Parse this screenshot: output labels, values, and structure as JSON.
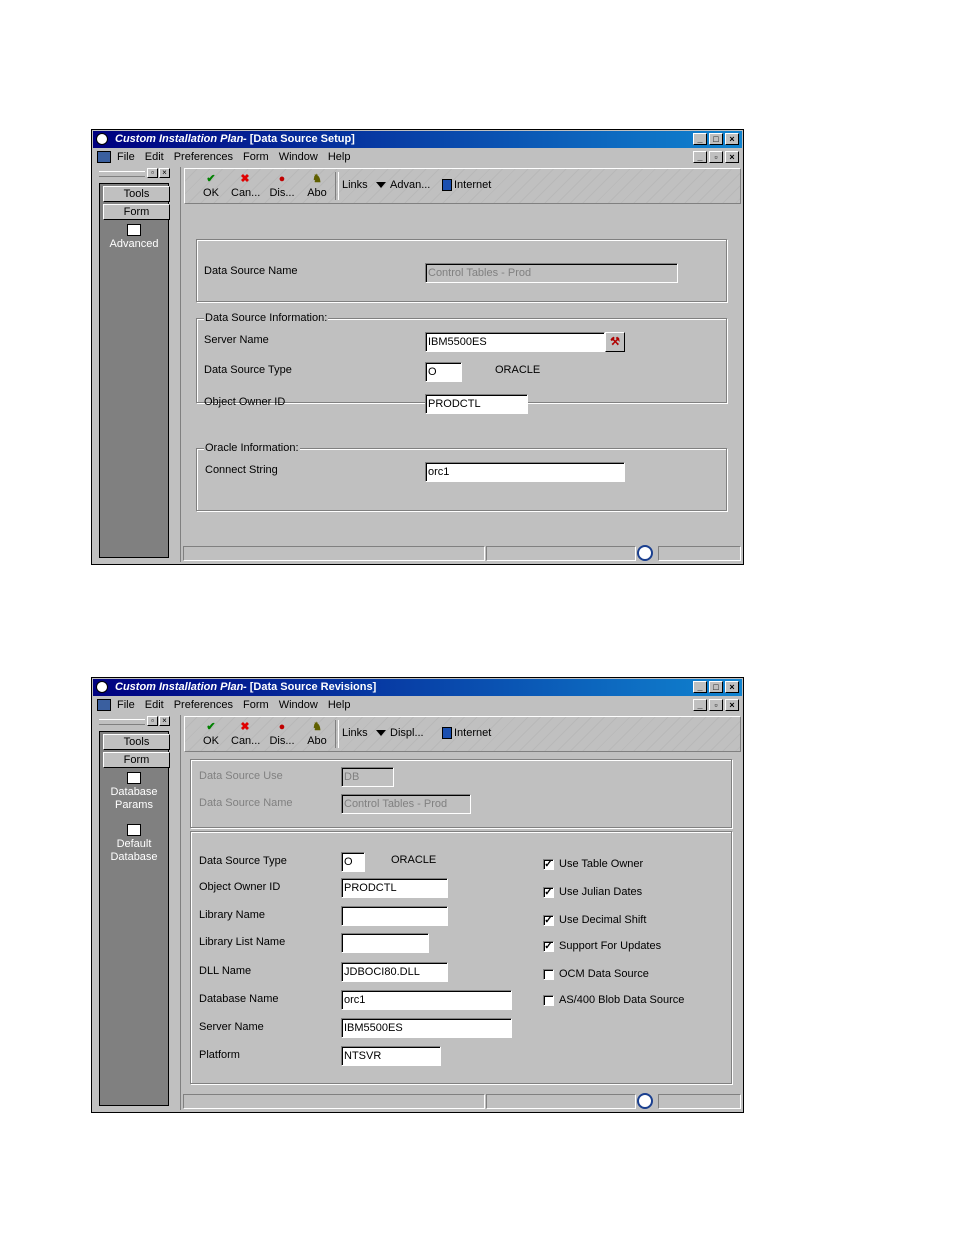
{
  "windows": [
    {
      "title": {
        "app": "Custom Installation Plan",
        "form": " - [Data Source Setup]"
      },
      "menu": [
        "File",
        "Edit",
        "Preferences",
        "Form",
        "Window",
        "Help"
      ],
      "left_panel": {
        "tabs": [
          "Tools",
          "Form"
        ],
        "items": [
          "Advanced"
        ]
      },
      "toolbar": {
        "buttons": [
          "OK",
          "Can...",
          "Dis...",
          "Abo"
        ],
        "links": "Links",
        "dropdown": "Advan...",
        "internet": "Internet"
      }
    },
    {
      "title": {
        "app": "Custom Installation Plan",
        "form": " - [Data Source Revisions]"
      },
      "menu": [
        "File",
        "Edit",
        "Preferences",
        "Form",
        "Window",
        "Help"
      ],
      "left_panel": {
        "tabs": [
          "Tools",
          "Form"
        ],
        "items": [
          "Database Params",
          "Default Database"
        ]
      },
      "toolbar": {
        "buttons": [
          "OK",
          "Can...",
          "Dis...",
          "Abo"
        ],
        "links": "Links",
        "dropdown": "Displ...",
        "internet": "Internet"
      }
    }
  ],
  "setup_form": {
    "data_source_name_label": "Data Source Name",
    "data_source_name_value": "Control Tables - Prod",
    "group_ds_info": "Data Source Information:",
    "server_name_label": "Server Name",
    "server_name_value": "IBM5500ES",
    "data_source_type_label": "Data Source Type",
    "data_source_type_value": "O",
    "data_source_type_desc": "ORACLE",
    "object_owner_label": "Object Owner ID",
    "object_owner_value": "PRODCTL",
    "group_oracle": "Oracle Information:",
    "connect_string_label": "Connect String",
    "connect_string_value": "orc1"
  },
  "revisions_form": {
    "data_source_use_label": "Data Source Use",
    "data_source_use_value": "DB",
    "data_source_name_label": "Data Source Name",
    "data_source_name_value": "Control Tables - Prod",
    "data_source_type_label": "Data Source Type",
    "data_source_type_value": "O",
    "data_source_type_desc": "ORACLE",
    "object_owner_label": "Object Owner ID",
    "object_owner_value": "PRODCTL",
    "library_name_label": "Library Name",
    "library_name_value": "",
    "library_list_label": "Library List Name",
    "library_list_value": "",
    "dll_name_label": "DLL Name",
    "dll_name_value": "JDBOCI80.DLL",
    "database_name_label": "Database Name",
    "database_name_value": "orc1",
    "server_name_label": "Server Name",
    "server_name_value": "IBM5500ES",
    "platform_label": "Platform",
    "platform_value": "NTSVR",
    "checkboxes": [
      {
        "label": "Use Table Owner",
        "checked": true
      },
      {
        "label": "Use Julian Dates",
        "checked": true
      },
      {
        "label": "Use Decimal Shift",
        "checked": true
      },
      {
        "label": "Support For Updates",
        "checked": true
      },
      {
        "label": "OCM Data Source",
        "checked": false
      },
      {
        "label": "AS/400 Blob Data Source",
        "checked": false
      }
    ]
  }
}
